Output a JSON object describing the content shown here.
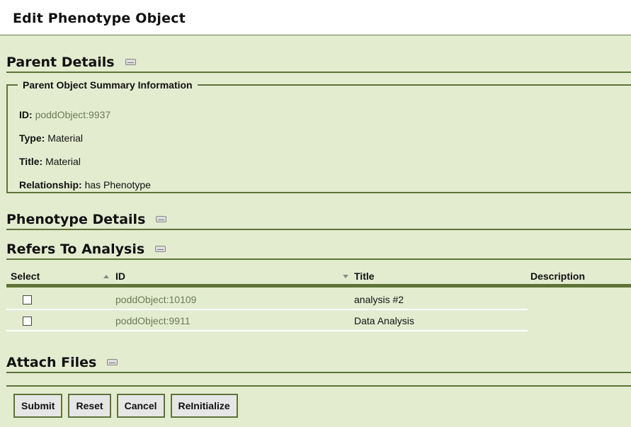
{
  "page": {
    "title": "Edit Phenotype Object"
  },
  "parent": {
    "heading": "Parent Details",
    "legend": "Parent Object Summary Information",
    "fields": [
      {
        "label": "ID:",
        "value": "poddObject:9937"
      },
      {
        "label": "Type:",
        "value": "Material"
      },
      {
        "label": "Title:",
        "value": "Material"
      },
      {
        "label": "Relationship:",
        "value": "has Phenotype"
      }
    ]
  },
  "phenotype": {
    "heading": "Phenotype Details"
  },
  "analysis": {
    "heading": "Refers To Analysis",
    "columns": {
      "select": "Select",
      "id": "ID",
      "title": "Title",
      "description": "Description"
    },
    "rows": [
      {
        "id": "poddObject:10109",
        "title": "analysis #2"
      },
      {
        "id": "poddObject:9911",
        "title": "Data Analysis"
      }
    ]
  },
  "files": {
    "heading": "Attach Files"
  },
  "buttons": {
    "submit": "Submit",
    "reset": "Reset",
    "cancel": "Cancel",
    "reinit": "ReInitialize"
  },
  "colors": {
    "background": "#e4ecd0",
    "rule": "#5e7437",
    "link": "#6b7a55"
  }
}
